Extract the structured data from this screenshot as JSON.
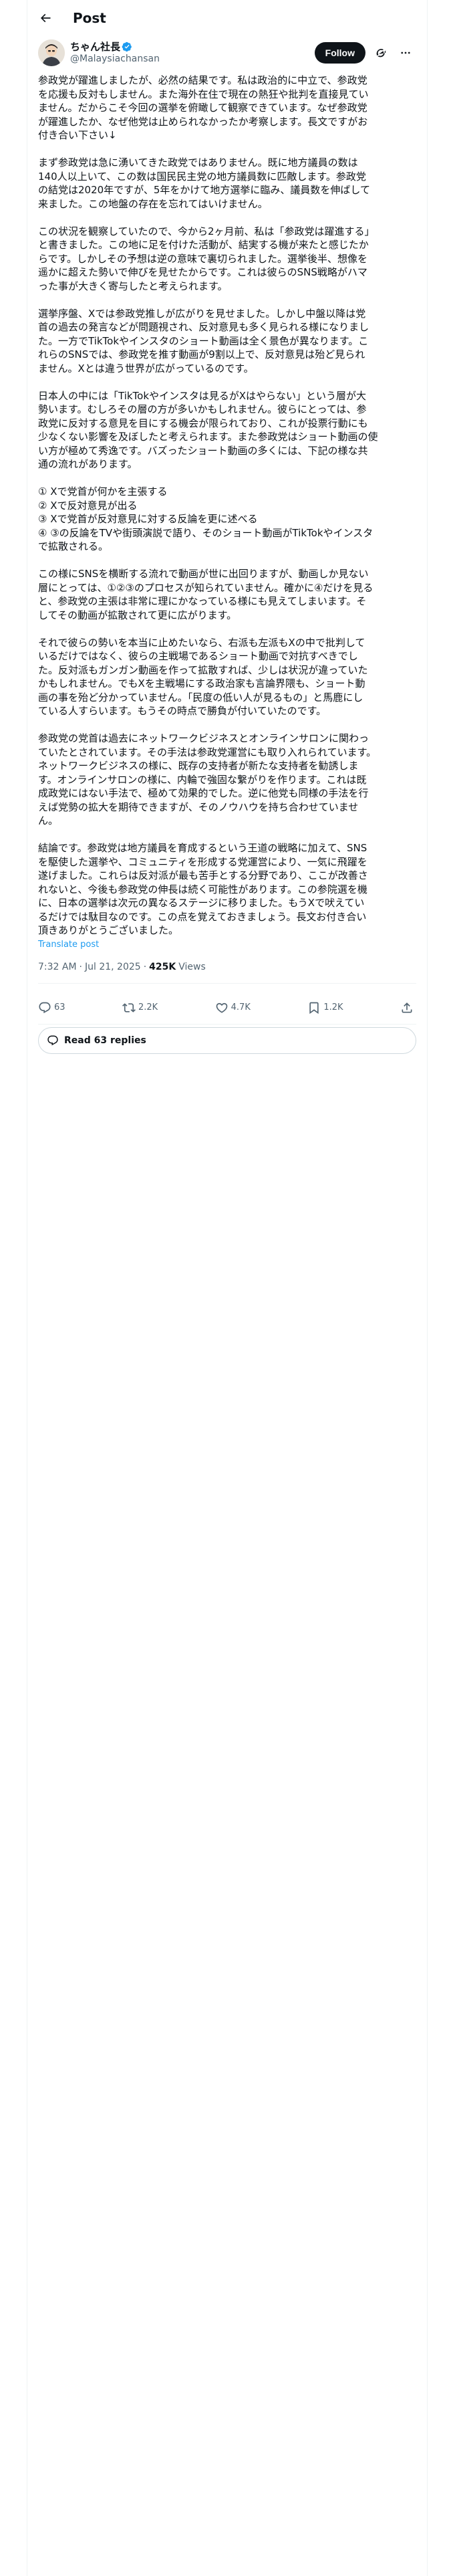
{
  "topbar": {
    "title": "Post"
  },
  "author": {
    "display_name": "ちゃん社長",
    "handle": "@Malaysiachansan"
  },
  "follow_label": "Follow",
  "tweet_paragraphs": [
    [
      "参政党が躍進しましたが、必然の結果です。私は政治的に中立で、参政党",
      "を応援も反対もしません。また海外在住で現在の熱狂や批判を直接見てい",
      "ません。だからこそ今回の選挙を俯瞰して観察できています。なぜ参政党",
      "が躍進したか、なぜ他党は止められなかったか考察します。長文ですがお",
      "付き合い下さい↓"
    ],
    [
      "まず参政党は急に湧いてきた政党ではありません。既に地方議員の数は",
      "140人以上いて、この数は国民民主党の地方議員数に匹敵します。参政党",
      "の結党は2020年ですが、5年をかけて地方選挙に臨み、議員数を伸ばして",
      "来ました。この地盤の存在を忘れてはいけません。"
    ],
    [
      "この状況を観察していたので、今から2ヶ月前、私は「参政党は躍進する」",
      "と書きました。この地に足を付けた活動が、結実する機が来たと感じたか",
      "らです。しかしその予想は逆の意味で裏切られました。選挙後半、想像を",
      "遥かに超えた勢いで伸びを見せたからです。これは彼らのSNS戦略がハマ",
      "った事が大きく寄与したと考えられます。"
    ],
    [
      "選挙序盤、Xでは参政党推しが広がりを見せました。しかし中盤以降は党",
      "首の過去の発言などが問題視され、反対意見も多く見られる様になりまし",
      "た。一方でTikTokやインスタのショート動画は全く景色が異なります。こ",
      "れらのSNSでは、参政党を推す動画が9割以上で、反対意見は殆ど見られ",
      "ません。Xとは違う世界が広がっているのです。"
    ],
    [
      "日本人の中には「TikTokやインスタは見るがXはやらない」という層が大",
      "勢います。むしろその層の方が多いかもしれません。彼らにとっては、参",
      "政党に反対する意見を目にする機会が限られており、これが投票行動にも",
      "少なくない影響を及ぼしたと考えられます。また参政党はショート動画の使",
      "い方が極めて秀逸です。バズったショート動画の多くには、下記の様な共",
      "通の流れがあります。"
    ],
    [
      "① Xで党首が何かを主張する",
      "② Xで反対意見が出る",
      "③ Xで党首が反対意見に対する反論を更に述べる",
      "④ ③の反論をTVや街頭演説で語り、そのショート動画がTikTokやインスタ",
      "で拡散される。"
    ],
    [
      "この様にSNSを横断する流れで動画が世に出回りますが、動画しか見ない",
      "層にとっては、①②③のプロセスが知られていません。確かに④だけを見る",
      "と、参政党の主張は非常に理にかなっている様にも見えてしまいます。そ",
      "してその動画が拡散されて更に広がります。"
    ],
    [
      "それで彼らの勢いを本当に止めたいなら、右派も左派もXの中で批判して",
      "いるだけではなく、彼らの主戦場であるショート動画で対抗すべきでし",
      "た。反対派もガンガン動画を作って拡散すれば、少しは状況が違っていた",
      "かもしれません。でもXを主戦場にする政治家も言論界隈も、ショート動",
      "画の事を殆ど分かっていません。「民度の低い人が見るもの」と馬鹿にし",
      "ている人すらいます。もうその時点で勝負が付いていたのです。"
    ],
    [
      "参政党の党首は過去にネットワークビジネスとオンラインサロンに関わっ",
      "ていたとされています。その手法は参政党運営にも取り入れられています。",
      "ネットワークビジネスの様に、既存の支持者が新たな支持者を勧誘しま",
      "す。オンラインサロンの様に、内輪で強固な繋がりを作ります。これは既",
      "成政党にはない手法で、極めて効果的でした。逆に他党も同様の手法を行",
      "えば党勢の拡大を期待できますが、そのノウハウを持ち合わせていませ",
      "ん。"
    ],
    [
      "結論です。参政党は地方議員を育成するという王道の戦略に加えて、SNS",
      "を駆使した選挙や、コミュニティを形成する党運営により、一気に飛躍を",
      "遂げました。これらは反対派が最も苦手とする分野であり、ここが改善さ",
      "れないと、今後も参政党の伸長は続く可能性があります。この参院選を機",
      "に、日本の選挙は次元の異なるステージに移りました。もうXで吠えてい",
      "るだけでは駄目なのです。この点を覚えておきましょう。長文お付き合い",
      "頂きありがとうございました。"
    ]
  ],
  "translate_label": "Translate post",
  "meta": {
    "time": "7:32 AM",
    "separator": "·",
    "date": "Jul 21, 2025",
    "views_count": "425K",
    "views_label": "Views"
  },
  "actions": {
    "replies": "63",
    "reposts": "2.2K",
    "likes": "4.7K",
    "bookmarks": "1.2K"
  },
  "read_replies_label": "Read 63 replies",
  "icons": {
    "back": "arrow-left-icon",
    "verified": "verified-badge-icon",
    "grok": "grok-icon",
    "more": "more-dots-icon",
    "reply": "reply-bubble-icon",
    "repost": "repost-arrows-icon",
    "like": "heart-icon",
    "bookmark": "bookmark-icon",
    "share": "share-upload-icon"
  },
  "colors": {
    "link": "#1d9bf0",
    "secondary_text": "#536471",
    "primary_text": "#0f1419",
    "verified": "#1d9bf0"
  }
}
